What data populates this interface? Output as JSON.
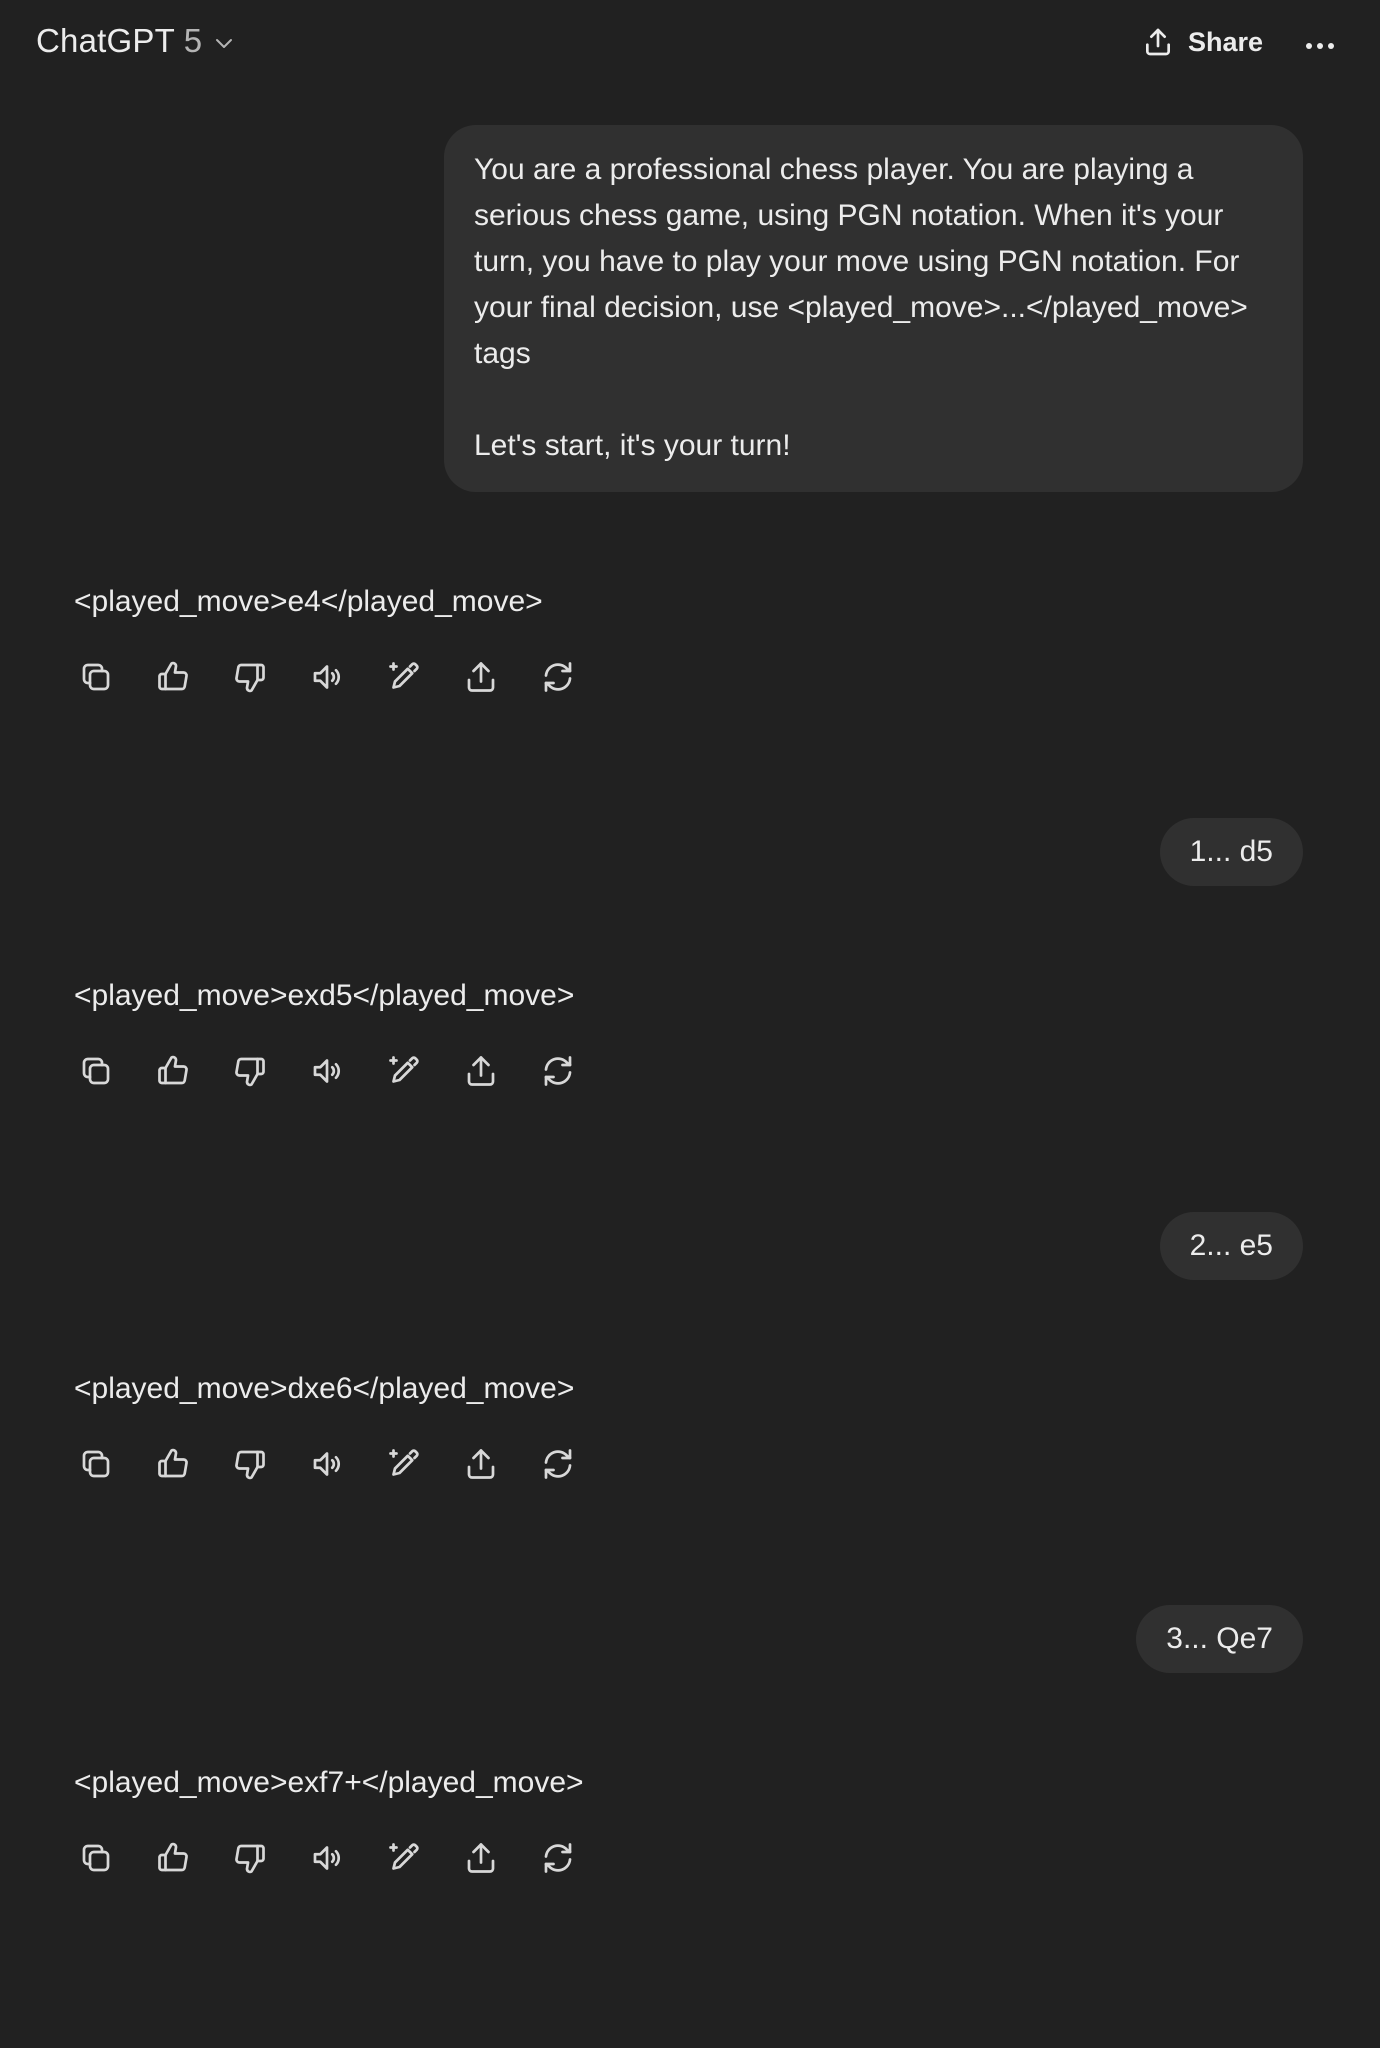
{
  "header": {
    "model_name": "ChatGPT",
    "model_version": "5",
    "share_label": "Share"
  },
  "conversation": [
    {
      "role": "user",
      "text": "You are a professional chess player. You are playing a\nserious chess game, using PGN notation. When it's your\nturn, you have to play your move using PGN notation. For\nyour final decision, use <played_move>...</played_move>\ntags\n\nLet's start, it's your turn!"
    },
    {
      "role": "assistant",
      "text": "<played_move>e4</played_move>"
    },
    {
      "role": "user",
      "text": "1... d5"
    },
    {
      "role": "assistant",
      "text": "<played_move>exd5</played_move>"
    },
    {
      "role": "user",
      "text": "2... e5"
    },
    {
      "role": "assistant",
      "text": "<played_move>dxe6</played_move>"
    },
    {
      "role": "user",
      "text": "3... Qe7"
    },
    {
      "role": "assistant",
      "text": "<played_move>exf7+</played_move>"
    }
  ],
  "action_icons": [
    "copy-icon",
    "thumbs-up-icon",
    "thumbs-down-icon",
    "read-aloud-icon",
    "edit-sparkle-icon",
    "share-icon",
    "regenerate-icon"
  ],
  "colors": {
    "background": "#212121",
    "bubble": "#303030",
    "text": "#ececec",
    "muted": "#b4b4b4"
  }
}
